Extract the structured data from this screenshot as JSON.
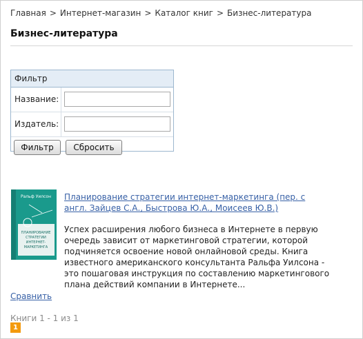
{
  "breadcrumb": {
    "items": [
      "Главная",
      "Интернет-магазин",
      "Каталог книг",
      "Бизнес-литература"
    ],
    "separator": ">"
  },
  "page": {
    "title": "Бизнес-литература"
  },
  "filter": {
    "header": "Фильтр",
    "name_label": "Название:",
    "name_value": "",
    "publisher_label": "Издатель:",
    "publisher_value": "",
    "submit_label": "Фильтр",
    "reset_label": "Сбросить"
  },
  "book": {
    "title": "Планирование стратегии интернет-маркетинга (пер. с англ. Зайцев С.А., Быстрова Ю.А., Моисеев Ю.В.)",
    "description": "Успех расширения любого бизнеса в Интернете в первую очередь зависит от маркетинговой стратегии, которой подчиняется освоение новой онлайновой среды. Книга известного американского консультанта Ральфа Уилсона - это пошаговая инструкция по составлению маркетингового плана действий компании в Интернете...",
    "cover": {
      "author": "Ральф Уилсон",
      "title_lines": [
        "ПЛАНИРОВАНИЕ",
        "СТРАТЕГИИ",
        "ИНТЕРНЕТ-",
        "МАРКЕТИНГА"
      ],
      "colors": {
        "primary": "#1a9a8c",
        "light": "#e8f2f0"
      }
    }
  },
  "compare_label": "Сравнить",
  "pager": {
    "info": "Книги 1 - 1 из 1",
    "current_page": "1"
  },
  "colors": {
    "link": "#3760a6",
    "filter_border": "#9cb7cf",
    "filter_header_bg": "#e4edf6",
    "pager_current": "#f39a0e"
  }
}
